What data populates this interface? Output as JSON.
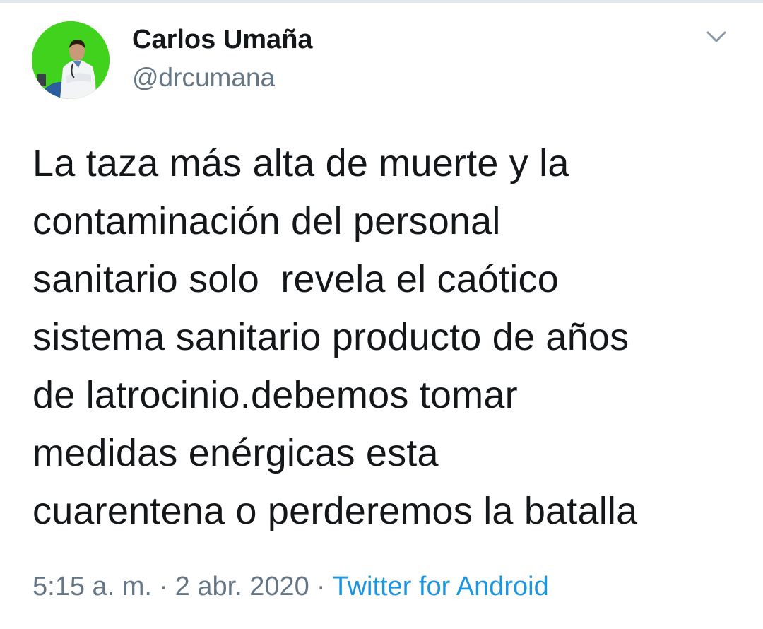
{
  "tweet": {
    "author": {
      "name": "Carlos Umaña",
      "handle": "@drcumana"
    },
    "text": "La taza más alta de muerte y la\ncontaminación del personal\nsanitario solo  revela el caótico\nsistema sanitario producto de años\nde latrocinio.debemos tomar\nmedidas enérgicas esta\ncuarentena o perderemos la batalla",
    "time": "5:15 a. m.",
    "separator": "·",
    "date": "2 abr. 2020",
    "source": "Twitter for Android"
  },
  "icons": {
    "menu": "chevron-down-icon"
  },
  "colors": {
    "text_primary": "#14171a",
    "text_secondary": "#657786",
    "link": "#1b95e0",
    "avatar_background": "#3fd11b"
  }
}
